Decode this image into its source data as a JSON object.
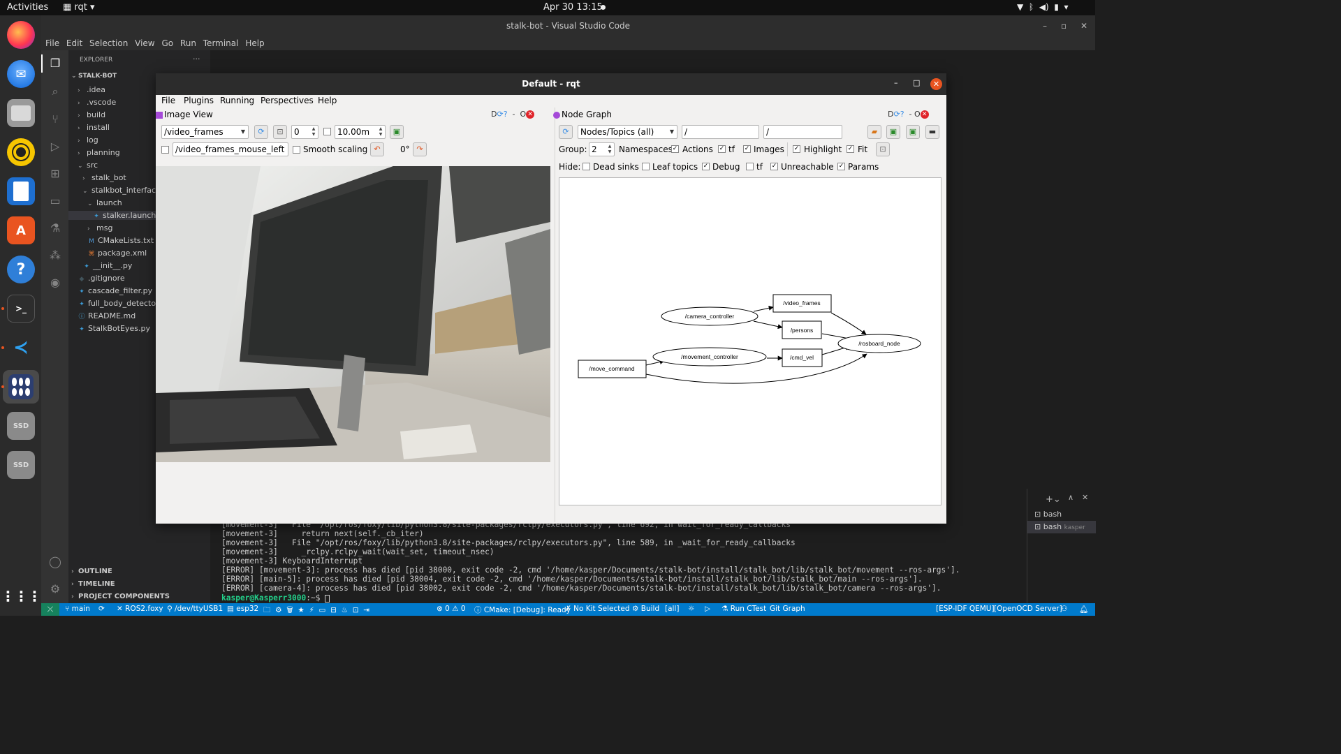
{
  "topbar": {
    "activities": "Activities",
    "app_menu": "rqt",
    "clock": "Apr 30  13:15"
  },
  "dock": {
    "apps": [
      "firefox-icon",
      "thunderbird-icon",
      "files-icon",
      "rhythmbox-icon",
      "writer-icon",
      "software-icon",
      "help-icon",
      "terminal-icon",
      "vscode-icon",
      "app-grid-icon",
      "ssd-drive-icon",
      "ssd-drive-icon",
      "show-apps-icon"
    ],
    "ssd_label": "SSD"
  },
  "vscode": {
    "window_title": "stalk-bot - Visual Studio Code",
    "menu": [
      "File",
      "Edit",
      "Selection",
      "View",
      "Go",
      "Run",
      "Terminal",
      "Help"
    ],
    "explorer": {
      "header": "EXPLORER",
      "more": "···",
      "root": "STALK-BOT",
      "tree": [
        {
          "label": ".idea",
          "kind": "folder",
          "depth": 1,
          "open": false
        },
        {
          "label": ".vscode",
          "kind": "folder",
          "depth": 1,
          "open": false
        },
        {
          "label": "build",
          "kind": "folder",
          "depth": 1,
          "open": false
        },
        {
          "label": "install",
          "kind": "folder",
          "depth": 1,
          "open": false
        },
        {
          "label": "log",
          "kind": "folder",
          "depth": 1,
          "open": false
        },
        {
          "label": "planning",
          "kind": "folder",
          "depth": 1,
          "open": false
        },
        {
          "label": "src",
          "kind": "folder",
          "depth": 1,
          "open": true
        },
        {
          "label": "stalk_bot",
          "kind": "folder",
          "depth": 2,
          "open": false
        },
        {
          "label": "stalkbot_interface",
          "kind": "folder",
          "depth": 2,
          "open": true
        },
        {
          "label": "launch",
          "kind": "folder",
          "depth": 3,
          "open": true
        },
        {
          "label": "stalker.launch.py",
          "kind": "py",
          "depth": 4,
          "selected": true
        },
        {
          "label": "msg",
          "kind": "folder",
          "depth": 3,
          "open": false
        },
        {
          "label": "CMakeLists.txt",
          "kind": "cmake",
          "depth": 3
        },
        {
          "label": "package.xml",
          "kind": "xml",
          "depth": 3
        },
        {
          "label": "__init__.py",
          "kind": "py",
          "depth": 2
        },
        {
          "label": ".gitignore",
          "kind": "git",
          "depth": 1
        },
        {
          "label": "cascade_filter.py",
          "kind": "py",
          "depth": 1
        },
        {
          "label": "full_body_detector.py",
          "kind": "py",
          "depth": 1
        },
        {
          "label": "README.md",
          "kind": "info",
          "depth": 1
        },
        {
          "label": "StalkBotEyes.py",
          "kind": "py",
          "depth": 1
        }
      ],
      "sections": [
        "OUTLINE",
        "TIMELINE",
        "PROJECT COMPONENTS"
      ]
    },
    "terminal": {
      "lines": [
        "[movement-3]   File \"/opt/ros/foxy/lib/python3.8/site-packages/rclpy/executors.py\", line 692, in wait_for_ready_callbacks",
        "[movement-3]     return next(self._cb_iter)",
        "[movement-3]   File \"/opt/ros/foxy/lib/python3.8/site-packages/rclpy/executors.py\", line 589, in _wait_for_ready_callbacks",
        "[movement-3]     _rclpy.rclpy_wait(wait_set, timeout_nsec)",
        "[movement-3] KeyboardInterrupt",
        "[ERROR] [movement-3]: process has died [pid 38000, exit code -2, cmd '/home/kasper/Documents/stalk-bot/install/stalk_bot/lib/stalk_bot/movement --ros-args'].",
        "[ERROR] [main-5]: process has died [pid 38004, exit code -2, cmd '/home/kasper/Documents/stalk-bot/install/stalk_bot/lib/stalk_bot/main --ros-args'].",
        "[ERROR] [camera-4]: process has died [pid 38002, exit code -2, cmd '/home/kasper/Documents/stalk-bot/install/stalk_bot/lib/stalk_bot/camera --ros-args']."
      ],
      "prompt_user": "kasper@Kasperr3000",
      "prompt_path": ":~$ ",
      "sessions": [
        {
          "name": "bash",
          "sub": ""
        },
        {
          "name": "bash",
          "sub": "kasper"
        }
      ]
    },
    "statusbar": {
      "branch": "main",
      "ros": "ROS2.foxy",
      "port": "/dev/ttyUSB1",
      "target": "esp32",
      "problems": "0 ⚠ 0",
      "cmake": "CMake: [Debug]: Ready",
      "kit": "No Kit Selected",
      "build": "Build",
      "all": "[all]",
      "ctest": "Run CTest",
      "gitgraph": "Git Graph",
      "qemu": "[ESP-IDF QEMU]",
      "openocd": "[OpenOCD Server]"
    }
  },
  "rqt": {
    "title": "Default - rqt",
    "menu": [
      "File",
      "Plugins",
      "Running",
      "Perspectives",
      "Help"
    ],
    "image_view": {
      "title": "Image View",
      "topic": "/video_frames",
      "spin_value": "0",
      "duration": "10.00m",
      "mouse_topic": "/video_frames_mouse_left",
      "smooth_scaling": "Smooth scaling",
      "rotation": "0°",
      "controls": "D",
      "close_label": "O"
    },
    "node_graph": {
      "title": "Node Graph",
      "mode": "Nodes/Topics (all)",
      "filter1": "/",
      "filter2": "/",
      "group_label": "Group:",
      "group_value": "2",
      "namespaces": "Namespaces",
      "actions": "Actions",
      "tf": "tf",
      "images": "Images",
      "highlight": "Highlight",
      "fit": "Fit",
      "hide_label": "Hide:",
      "dead_sinks": "Dead sinks",
      "leaf_topics": "Leaf topics",
      "debug": "Debug",
      "tf2": "tf",
      "unreachable": "Unreachable",
      "params": "Params",
      "nodes": [
        "/camera_controller",
        "/movement_controller",
        "/rosboard_node"
      ],
      "topics": [
        "/video_frames",
        "/persons",
        "/cmd_vel",
        "/move_command"
      ]
    }
  }
}
